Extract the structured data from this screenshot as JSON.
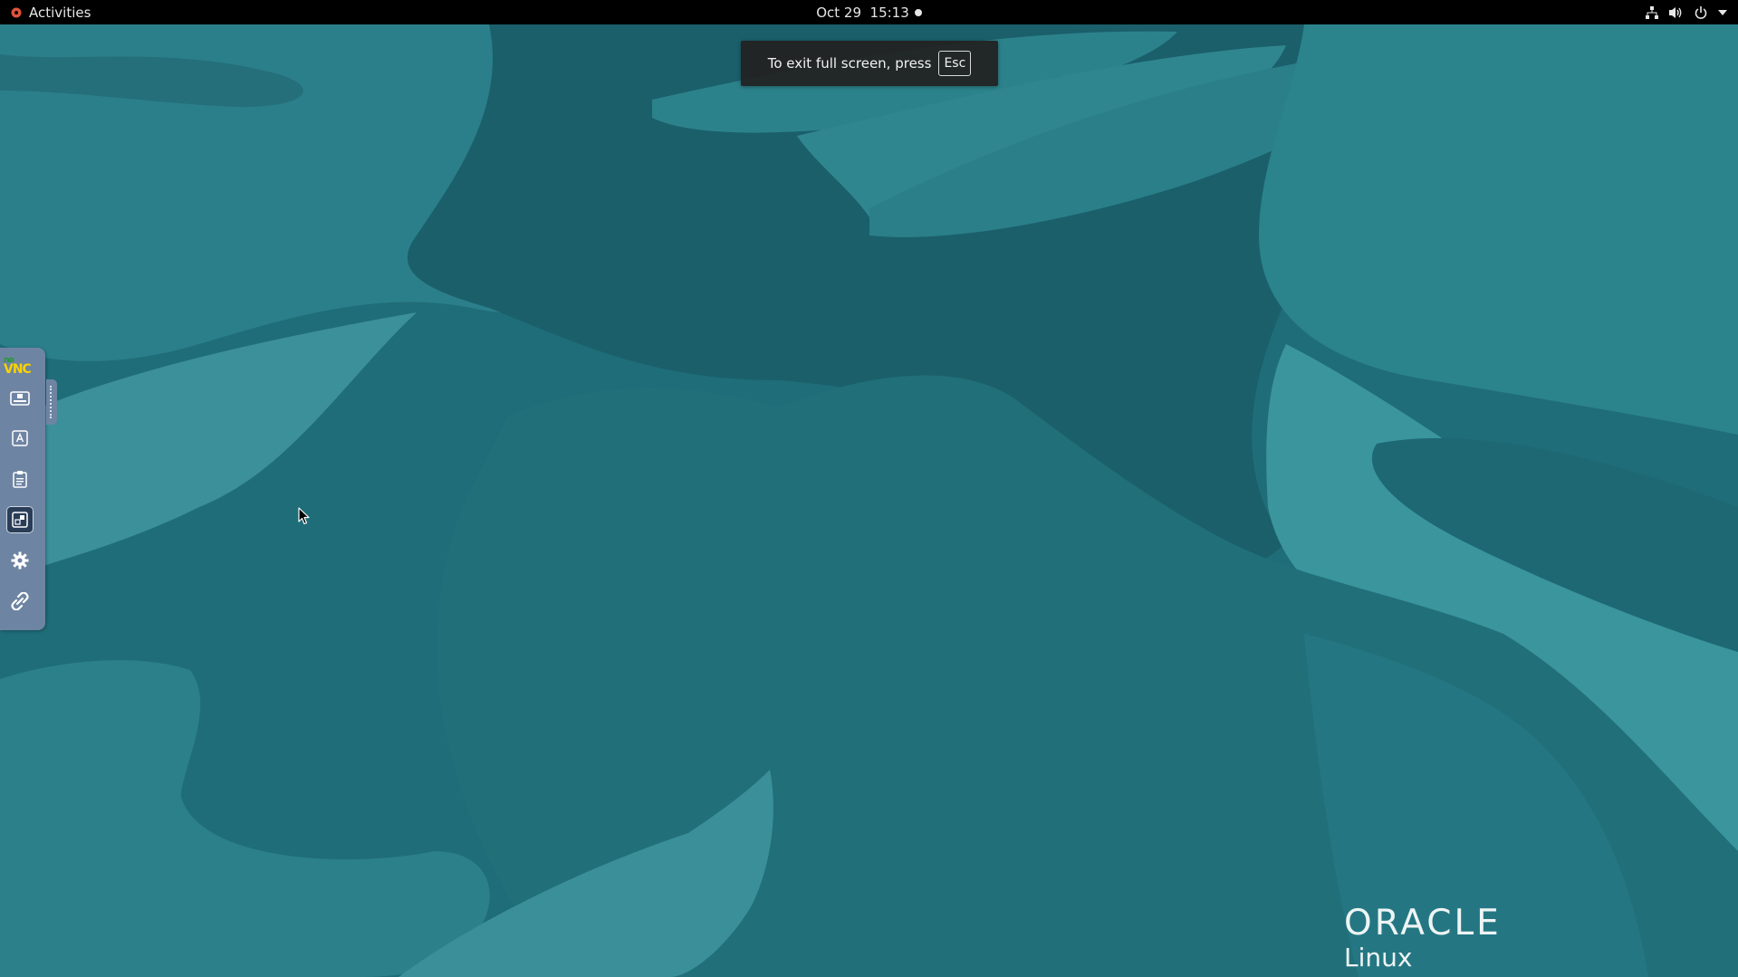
{
  "topbar": {
    "activities_label": "Activities",
    "clock_text": "Oct 29  15:13",
    "tray_icons": [
      "network-icon",
      "volume-icon",
      "power-icon",
      "chevron-down-icon"
    ]
  },
  "fullscreen_notice": {
    "message": "To exit full screen, press",
    "key": "Esc"
  },
  "novnc": {
    "logo_no": "no",
    "logo_vnc": "VNC",
    "buttons": [
      {
        "name": "extra-keys-icon",
        "active": false
      },
      {
        "name": "keyboard-icon",
        "active": false
      },
      {
        "name": "clipboard-icon",
        "active": false
      },
      {
        "name": "fullscreen-icon",
        "active": true
      },
      {
        "name": "settings-gear-icon",
        "active": false
      },
      {
        "name": "disconnect-icon",
        "active": false
      }
    ]
  },
  "desktop": {
    "brand_word": "ORACLE",
    "brand_sub": "Linux"
  },
  "colors": {
    "wallpaper_base": "#1f6d78",
    "wallpaper_dark": "#1a5f6a",
    "wallpaper_light": "#2f8a93",
    "topbar": "#000000",
    "novnc_bar": "#6e84a3",
    "novnc_logo_yellow": "#f8d300"
  }
}
